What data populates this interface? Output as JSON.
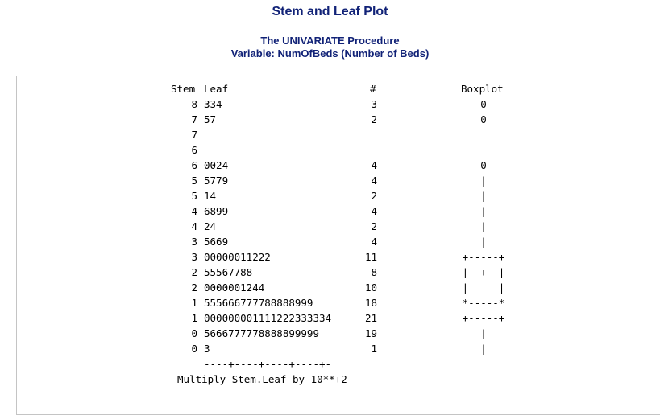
{
  "title": "Stem and Leaf Plot",
  "procedure": "The UNIVARIATE Procedure",
  "variable": "Variable: NumOfBeds (Number of Beds)",
  "header": {
    "stem": "Stem",
    "leaf": "Leaf",
    "count": "#",
    "boxplot": "Boxplot"
  },
  "rows": [
    {
      "stem": "8",
      "leaf": "334",
      "count": "3",
      "box": "0"
    },
    {
      "stem": "7",
      "leaf": "57",
      "count": "2",
      "box": "0"
    },
    {
      "stem": "7",
      "leaf": "",
      "count": "",
      "box": ""
    },
    {
      "stem": "6",
      "leaf": "",
      "count": "",
      "box": ""
    },
    {
      "stem": "6",
      "leaf": "0024",
      "count": "4",
      "box": "0"
    },
    {
      "stem": "5",
      "leaf": "5779",
      "count": "4",
      "box": "|"
    },
    {
      "stem": "5",
      "leaf": "14",
      "count": "2",
      "box": "|"
    },
    {
      "stem": "4",
      "leaf": "6899",
      "count": "4",
      "box": "|"
    },
    {
      "stem": "4",
      "leaf": "24",
      "count": "2",
      "box": "|"
    },
    {
      "stem": "3",
      "leaf": "5669",
      "count": "4",
      "box": "|"
    },
    {
      "stem": "3",
      "leaf": "00000011222",
      "count": "11",
      "box": "+-----+"
    },
    {
      "stem": "2",
      "leaf": "55567788",
      "count": "8",
      "box": "|  +  |"
    },
    {
      "stem": "2",
      "leaf": "0000001244",
      "count": "10",
      "box": "|     |"
    },
    {
      "stem": "1",
      "leaf": "555666777788888999",
      "count": "18",
      "box": "*-----*"
    },
    {
      "stem": "1",
      "leaf": "000000001111222333334",
      "count": "21",
      "box": "+-----+"
    },
    {
      "stem": "0",
      "leaf": "5666777778888899999",
      "count": "19",
      "box": "|"
    },
    {
      "stem": "0",
      "leaf": "3",
      "count": "1",
      "box": "|"
    }
  ],
  "scale_line": "----+----+----+----+-",
  "footer": "Multiply Stem.Leaf by 10**+2"
}
